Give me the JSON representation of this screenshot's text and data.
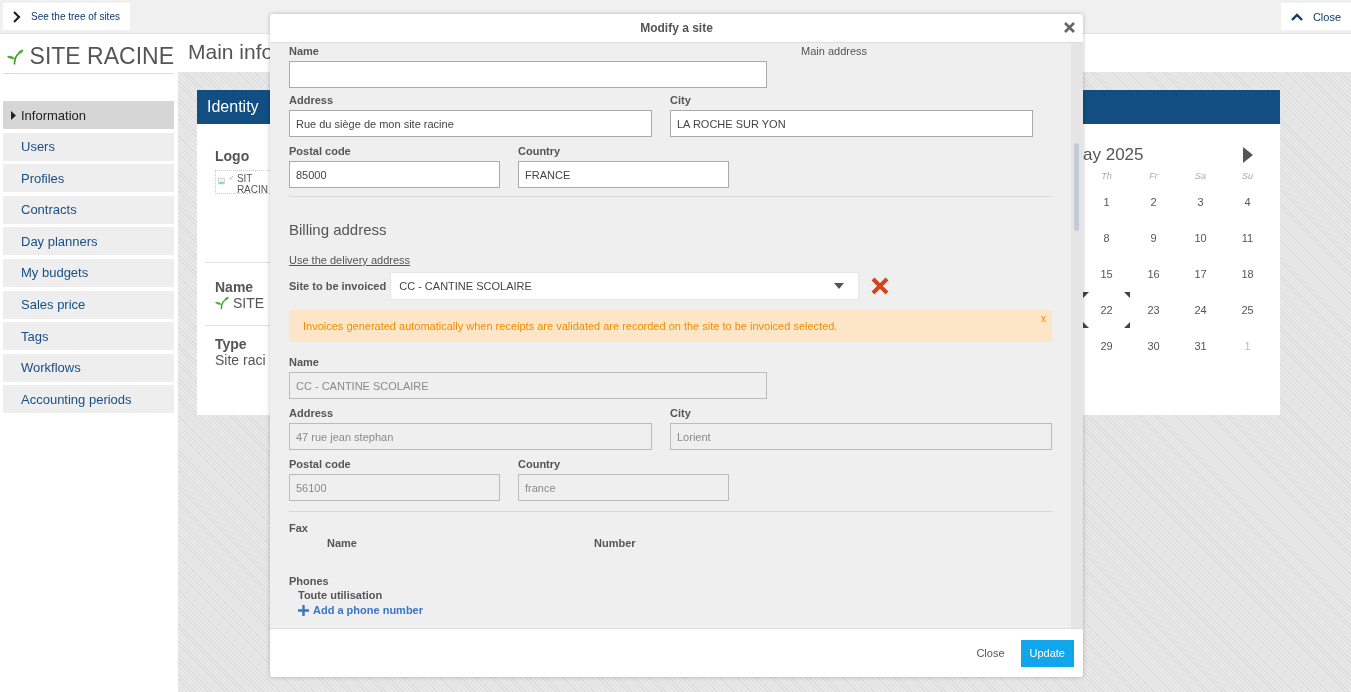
{
  "top_bar": {
    "tree_button": "See the tree of sites",
    "close_button": "Close"
  },
  "site_title": "SITE RACINE",
  "sidebar": {
    "items": [
      {
        "label": "Information",
        "selected": true
      },
      {
        "label": "Users",
        "selected": false
      },
      {
        "label": "Profiles",
        "selected": false
      },
      {
        "label": "Contracts",
        "selected": false
      },
      {
        "label": "Day planners",
        "selected": false
      },
      {
        "label": "My budgets",
        "selected": false
      },
      {
        "label": "Sales price",
        "selected": false
      },
      {
        "label": "Tags",
        "selected": false
      },
      {
        "label": "Workflows",
        "selected": false
      },
      {
        "label": "Accounting periods",
        "selected": false
      }
    ]
  },
  "page_title": "Main info",
  "identity": {
    "header": "Identity",
    "logo_label": "Logo",
    "logo_alt": [
      "SIT",
      "RACIN"
    ],
    "name_label": "Name",
    "name_value": "SITE",
    "type_label": "Type",
    "type_value": "Site raci"
  },
  "calendar": {
    "title": "ay 2025",
    "weekdays": [
      "Th",
      "Fr",
      "Sa",
      "Su"
    ],
    "weeks": [
      [
        {
          "label": "1",
          "other_month": false,
          "selected": false
        },
        {
          "label": "2",
          "other_month": false,
          "selected": false
        },
        {
          "label": "3",
          "other_month": false,
          "selected": false
        },
        {
          "label": "4",
          "other_month": false,
          "selected": false
        }
      ],
      [
        {
          "label": "8",
          "other_month": false,
          "selected": false
        },
        {
          "label": "9",
          "other_month": false,
          "selected": false
        },
        {
          "label": "10",
          "other_month": false,
          "selected": false
        },
        {
          "label": "11",
          "other_month": false,
          "selected": false
        }
      ],
      [
        {
          "label": "15",
          "other_month": false,
          "selected": false
        },
        {
          "label": "16",
          "other_month": false,
          "selected": false
        },
        {
          "label": "17",
          "other_month": false,
          "selected": false
        },
        {
          "label": "18",
          "other_month": false,
          "selected": false
        }
      ],
      [
        {
          "label": "22",
          "other_month": false,
          "selected": true
        },
        {
          "label": "23",
          "other_month": false,
          "selected": false
        },
        {
          "label": "24",
          "other_month": false,
          "selected": false
        },
        {
          "label": "25",
          "other_month": false,
          "selected": false
        }
      ],
      [
        {
          "label": "29",
          "other_month": false,
          "selected": false
        },
        {
          "label": "30",
          "other_month": false,
          "selected": false
        },
        {
          "label": "31",
          "other_month": false,
          "selected": false
        },
        {
          "label": "1",
          "other_month": true,
          "selected": false
        }
      ]
    ]
  },
  "modal": {
    "title": "Modify a site",
    "main_address_label": "Main address",
    "delivery_rows": [
      [
        {
          "label": "Name",
          "kind": "wide",
          "disabled": false
        }
      ],
      [
        {
          "label": "Address",
          "value": "Rue du siège de mon site racine",
          "kind": "half",
          "disabled": false
        },
        {
          "label": "City",
          "value": "LA ROCHE SUR YON",
          "kind": "half",
          "disabled": false
        }
      ],
      [
        {
          "label": "Postal code",
          "value": "85000",
          "kind": "short",
          "disabled": false
        },
        {
          "label": "Country",
          "value": "FRANCE",
          "kind": "short",
          "disabled": false
        }
      ]
    ],
    "billing_heading": "Billing address",
    "use_delivery_link": "Use the delivery address",
    "site_to_invoice_label": "Site to be invoiced",
    "site_to_invoice_value": "CC - CANTINE SCOLAIRE",
    "alert": {
      "text": "Invoices generated automatically when receipts are validated are recorded on the site to be invoiced selected.",
      "close": "x"
    },
    "billing_rows": [
      [
        {
          "label": "Name",
          "value": "CC - CANTINE SCOLAIRE",
          "kind": "wide",
          "disabled": true
        }
      ],
      [
        {
          "label": "Address",
          "value": "47 rue jean stephan",
          "kind": "half",
          "disabled": true
        },
        {
          "label": "City",
          "value": "Lorient",
          "kind": "full",
          "disabled": true
        }
      ],
      [
        {
          "label": "Postal code",
          "value": "56100",
          "kind": "short",
          "disabled": true
        },
        {
          "label": "Country",
          "value": "france",
          "kind": "short",
          "disabled": true
        }
      ]
    ],
    "fax": {
      "label": "Fax",
      "columns": [
        "Name",
        "Number"
      ]
    },
    "phones": {
      "label": "Phones",
      "group": "Toute utilisation",
      "add_link": "Add a phone number"
    },
    "footer": {
      "close": "Close",
      "update": "Update"
    }
  }
}
